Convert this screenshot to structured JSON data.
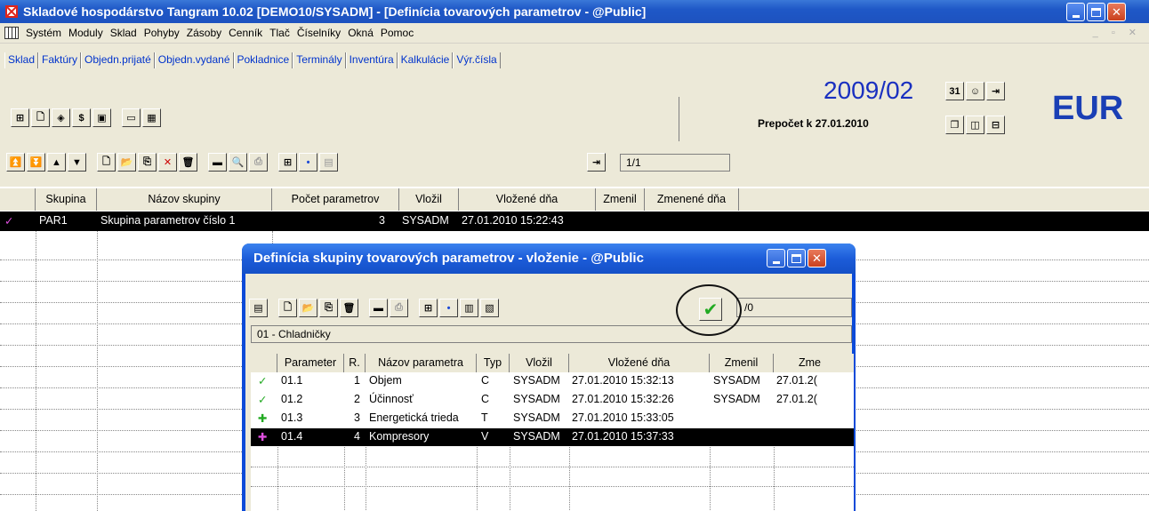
{
  "window": {
    "title": "Skladové hospodárstvo Tangram 10.02 [DEMO10/SYSADM] - [Definícia tovarových parametrov - @Public]"
  },
  "menu": [
    "Systém",
    "Moduly",
    "Sklad",
    "Pohyby",
    "Zásoby",
    "Cenník",
    "Tlač",
    "Číselníky",
    "Okná",
    "Pomoc"
  ],
  "tabs": [
    "Sklad",
    "Faktúry",
    "Objedn.prijaté",
    "Objedn.vydané",
    "Pokladnice",
    "Terminály",
    "Inventúra",
    "Kalkulácie",
    "Výr.čísla"
  ],
  "period": "2009/02",
  "prepocet": "Prepočet k 27.01.2010",
  "currency": "EUR",
  "record_counter": "1/1",
  "grid": {
    "columns": [
      "Skupina",
      "Názov skupiny",
      "Počet parametrov",
      "Vložil",
      "Vložené dňa",
      "Zmenil",
      "Zmenené dňa"
    ],
    "rows": [
      {
        "skupina": "PAR1",
        "nazov": "Skupina parametrov číslo 1",
        "pocet": "3",
        "vlozil": "SYSADM",
        "vlozene": "27.01.2010 15:22:43"
      }
    ]
  },
  "dialog": {
    "title": "Definícia skupiny tovarových parametrov - vloženie - @Public",
    "counter": "/0",
    "group": "01 - Chladničky",
    "columns": [
      "Parameter",
      "R.",
      "Názov parametra",
      "Typ",
      "Vložil",
      "Vložené dňa",
      "Zmenil",
      "Zme"
    ],
    "rows": [
      {
        "param": "01.1",
        "r": "1",
        "nazov": "Objem",
        "typ": "C",
        "vlozil": "SYSADM",
        "vlozene": "27.01.2010 15:32:13",
        "zmenil": "SYSADM",
        "zme": "27.01.2("
      },
      {
        "param": "01.2",
        "r": "2",
        "nazov": "Účinnosť",
        "typ": "C",
        "vlozil": "SYSADM",
        "vlozene": "27.01.2010 15:32:26",
        "zmenil": "SYSADM",
        "zme": "27.01.2("
      },
      {
        "param": "01.3",
        "r": "3",
        "nazov": "Energetická trieda",
        "typ": "T",
        "vlozil": "SYSADM",
        "vlozene": "27.01.2010 15:33:05",
        "zmenil": "",
        "zme": ""
      },
      {
        "param": "01.4",
        "r": "4",
        "nazov": "Kompresory",
        "typ": "V",
        "vlozil": "SYSADM",
        "vlozene": "27.01.2010 15:37:33",
        "zmenil": "",
        "zme": ""
      }
    ]
  }
}
